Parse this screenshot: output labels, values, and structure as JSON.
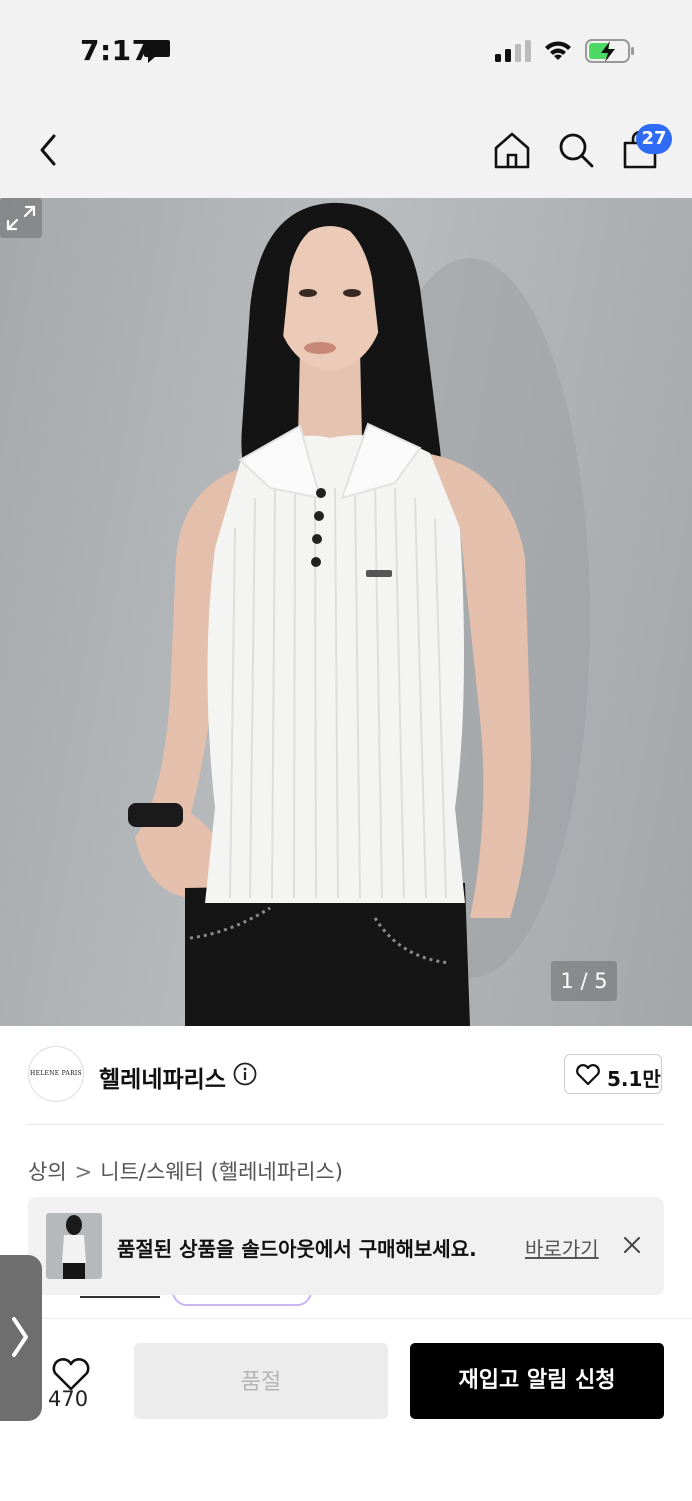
{
  "status_bar": {
    "time": "7:17"
  },
  "nav": {
    "cart_count": "27"
  },
  "gallery": {
    "counter": "1 / 5"
  },
  "brand": {
    "logo_text": "HELENE PARIS",
    "name": "헬레네파리스",
    "like_count": "5.1만"
  },
  "breadcrumb": {
    "category": "상의",
    "subcategory": "니트/스웨터 (헬레네파리스)"
  },
  "banner": {
    "message": "품절된 상품을 솔드아웃에서 구매해보세요.",
    "link_label": "바로가기"
  },
  "bottom": {
    "wish_count": "470",
    "soldout_label": "품절",
    "restock_label": "재입고 알림 신청"
  },
  "colors": {
    "badge": "#2f6bf4",
    "primary_button": "#000000",
    "disabled_button": "#ececec"
  }
}
